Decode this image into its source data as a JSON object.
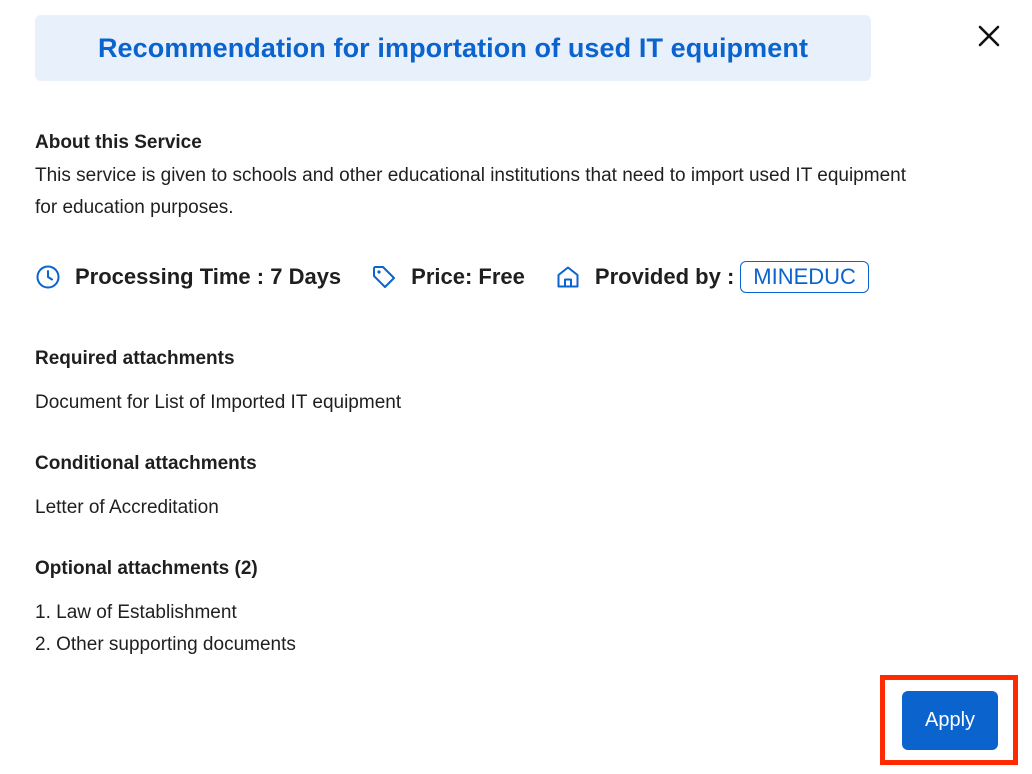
{
  "dialog": {
    "title": "Recommendation for importation of used IT equipment",
    "close_icon": "close-icon"
  },
  "about": {
    "heading": "About this Service",
    "text": "This service is given to schools and other educational institutions that need to import used IT equipment for education purposes."
  },
  "meta": {
    "processing_time": "Processing Time : 7 Days",
    "price": "Price: Free",
    "provided_by_label": "Provided by :",
    "provider": "MINEDUC",
    "icons": [
      "clock-icon",
      "tag-icon",
      "building-icon"
    ]
  },
  "attachments": {
    "required_heading": "Required attachments",
    "required_items": [
      "Document for List of Imported IT equipment"
    ],
    "conditional_heading": "Conditional attachments",
    "conditional_items": [
      "Letter of Accreditation"
    ],
    "optional_heading": "Optional attachments (2)",
    "optional_items": [
      "1. Law of Establishment",
      "2. Other supporting documents"
    ]
  },
  "actions": {
    "apply_label": "Apply"
  },
  "colors": {
    "accent": "#0b63ce",
    "title_bg": "#e8f1fb",
    "highlight": "#ff2a00"
  }
}
